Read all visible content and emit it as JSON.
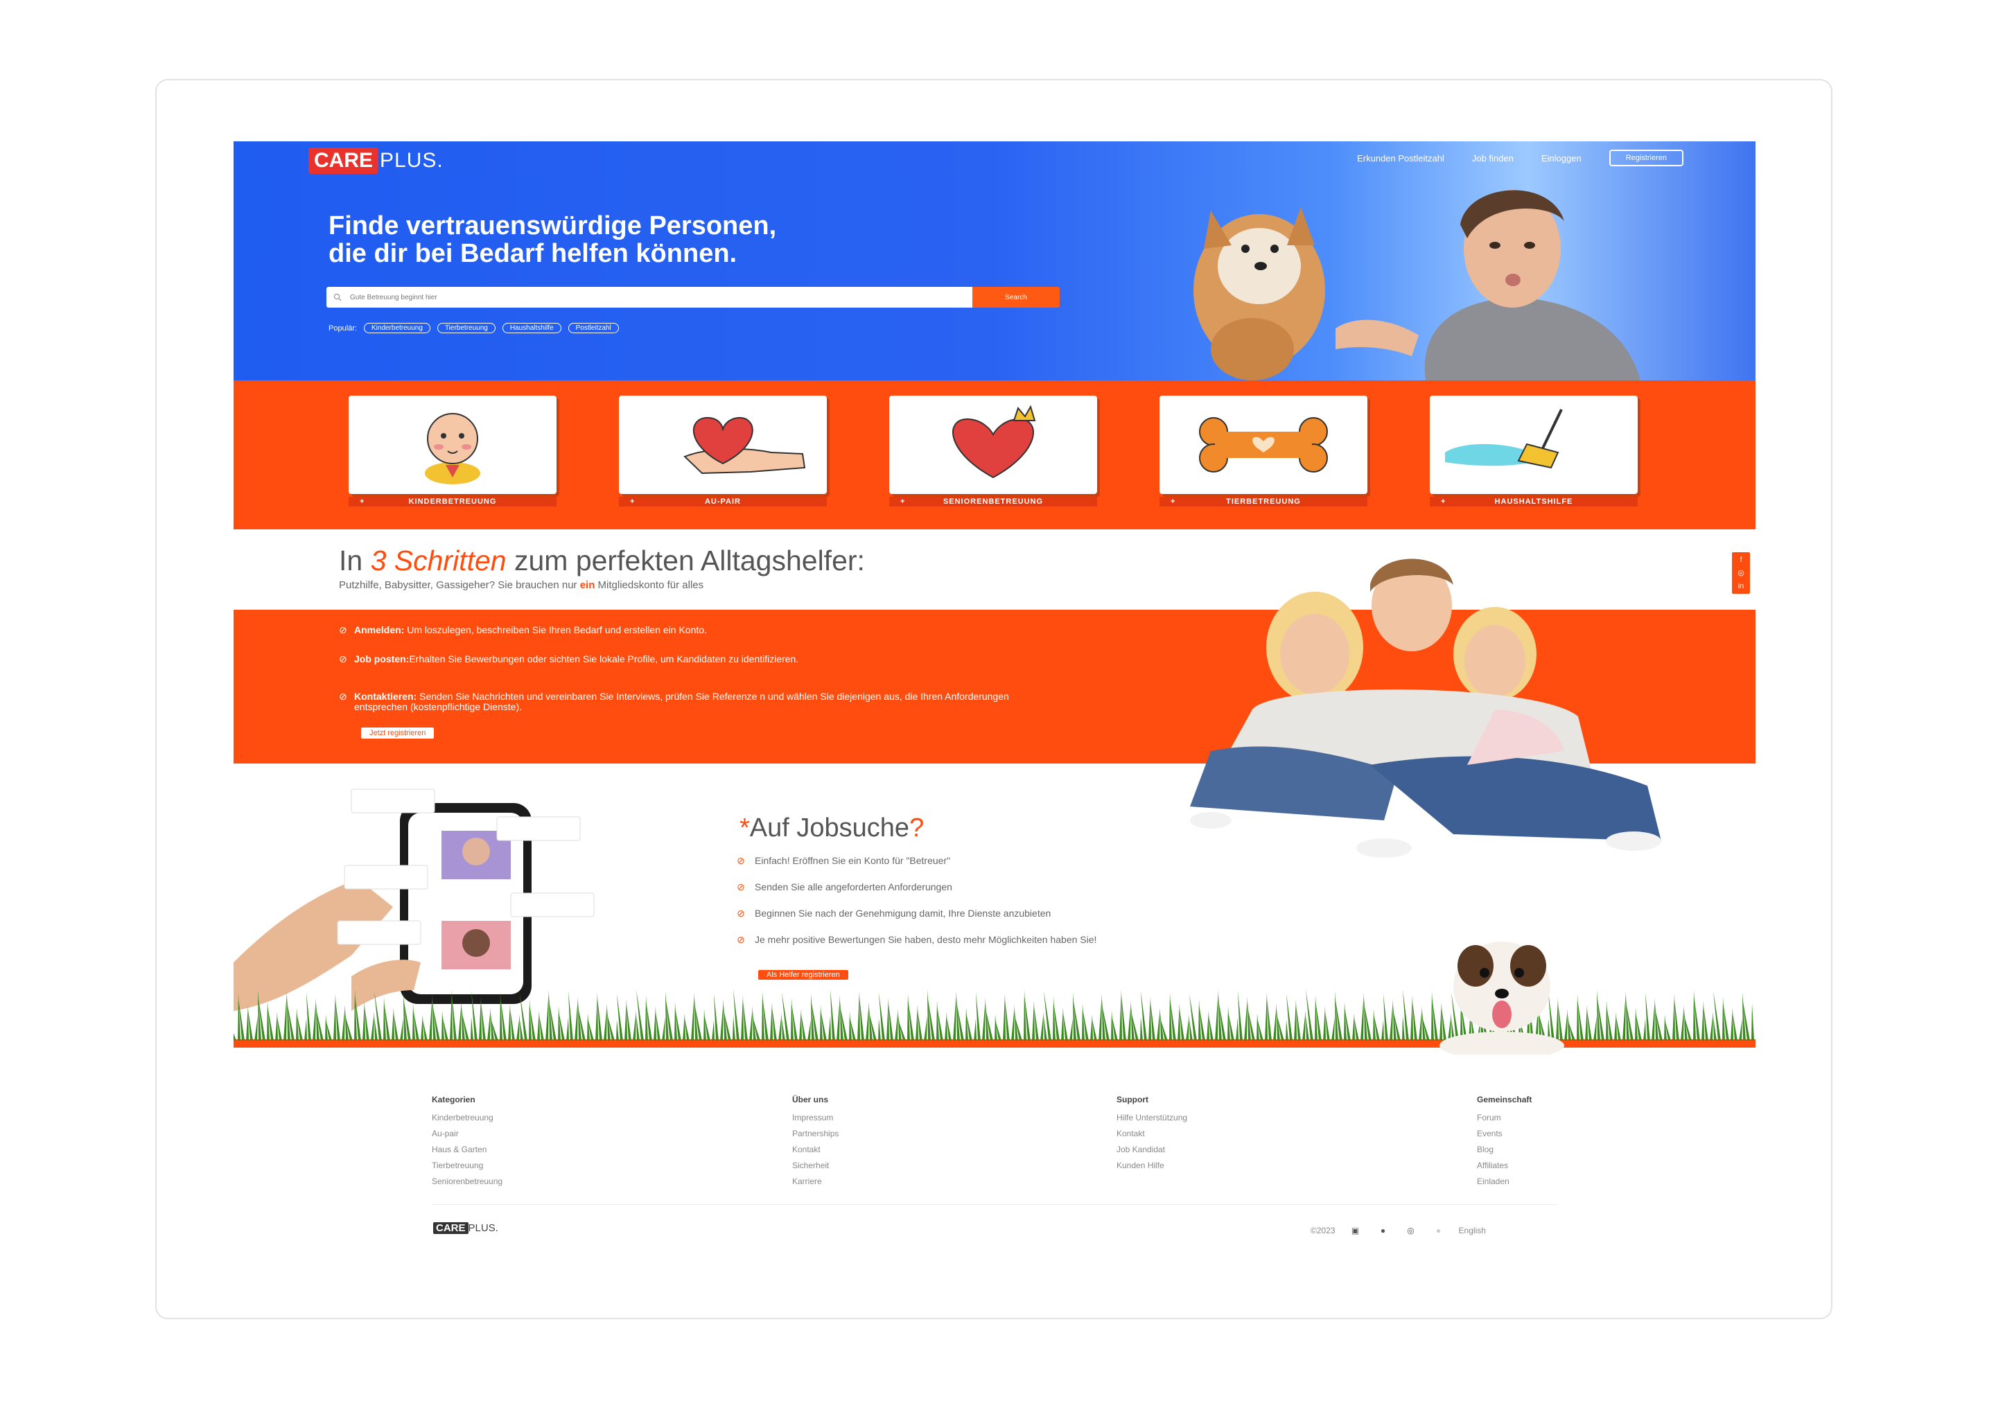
{
  "header": {
    "logo_care": "CARE",
    "logo_plus": "PLUS.",
    "nav": [
      "Erkunden Postleitzahl",
      "Job finden",
      "Einloggen"
    ],
    "register": "Registrieren"
  },
  "hero": {
    "title_line1": "Finde vertrauenswürdige Personen,",
    "title_line2": "die dir bei Bedarf helfen können.",
    "search_placeholder": "Gute Betreuung beginnt hier",
    "search_button": "Search",
    "popular_label": "Populär:",
    "popular_tags": [
      "Kinderbetreuung",
      "Tierbetreuung",
      "Haushaltshilfe",
      "Postleitzahl"
    ]
  },
  "categories": [
    {
      "label": "KINDERBETREUUNG",
      "icon": "baby-icon"
    },
    {
      "label": "AU-PAIR",
      "icon": "heart-hand-icon"
    },
    {
      "label": "SENIORENBETREUUNG",
      "icon": "heart-crown-icon"
    },
    {
      "label": "TIERBETREUUNG",
      "icon": "bone-icon"
    },
    {
      "label": "HAUSHALTSHILFE",
      "icon": "broom-icon"
    }
  ],
  "steps": {
    "title_prefix": "In ",
    "title_highlight": "3 Schritten",
    "title_suffix": " zum perfekten Alltagshelfer:",
    "subtitle_prefix": "Putzhilfe, Babysitter, Gassigeher? Sie brauchen nur ",
    "subtitle_highlight": "ein",
    "subtitle_suffix": " Mitgliedskonto für alles",
    "items": [
      {
        "bold": "Anmelden:",
        "text": " Um loszulegen, beschreiben Sie Ihren Bedarf und erstellen ein Konto."
      },
      {
        "bold": "Job posten:",
        "text": "Erhalten Sie Bewerbungen oder sichten Sie lokale Profile, um Kandidaten zu identifizieren."
      },
      {
        "bold": "Kontaktieren:",
        "text": " Senden Sie Nachrichten und vereinbaren Sie Interviews, prüfen Sie Referenze n und wählen Sie diejenigen aus, die Ihren Anforderungen entsprechen (kostenpflichtige Dienste)."
      }
    ],
    "button": "Jetzt registrieren"
  },
  "jobs": {
    "title_star": "*",
    "title": "Auf Jobsuche",
    "title_q": "?",
    "items": [
      "Einfach! Eröffnen Sie ein Konto für \"Betreuer\"",
      "Senden Sie alle angeforderten Anforderungen",
      "Beginnen Sie nach der Genehmigung damit, Ihre Dienste anzubieten",
      "Je mehr positive Bewertungen Sie haben, desto mehr Möglichkeiten haben Sie!"
    ],
    "button": "Als Helfer registrieren"
  },
  "footer": {
    "columns": [
      {
        "title": "Kategorien",
        "links": [
          "Kinderbetreuung",
          "Au-pair",
          "Haus & Garten",
          "Tierbetreuung",
          "Seniorenbetreuung"
        ]
      },
      {
        "title": "Über uns",
        "links": [
          "Impressum",
          "Partnerships",
          "Kontakt",
          "Sicherheit",
          "Karriere"
        ]
      },
      {
        "title": "Support",
        "links": [
          "Hilfe Unterstützung",
          "Kontakt",
          "Job Kandidat",
          "Kunden Hilfe"
        ]
      },
      {
        "title": "Gemeinschaft",
        "links": [
          "Forum",
          "Events",
          "Blog",
          "Affiliates",
          "Einladen"
        ]
      }
    ],
    "logo_care": "CARE",
    "logo_plus": "PLUS.",
    "copyright": "©2023",
    "language": "English"
  },
  "colors": {
    "primary_blue": "#1f5cf0",
    "accent_orange": "#ff4d0f"
  }
}
